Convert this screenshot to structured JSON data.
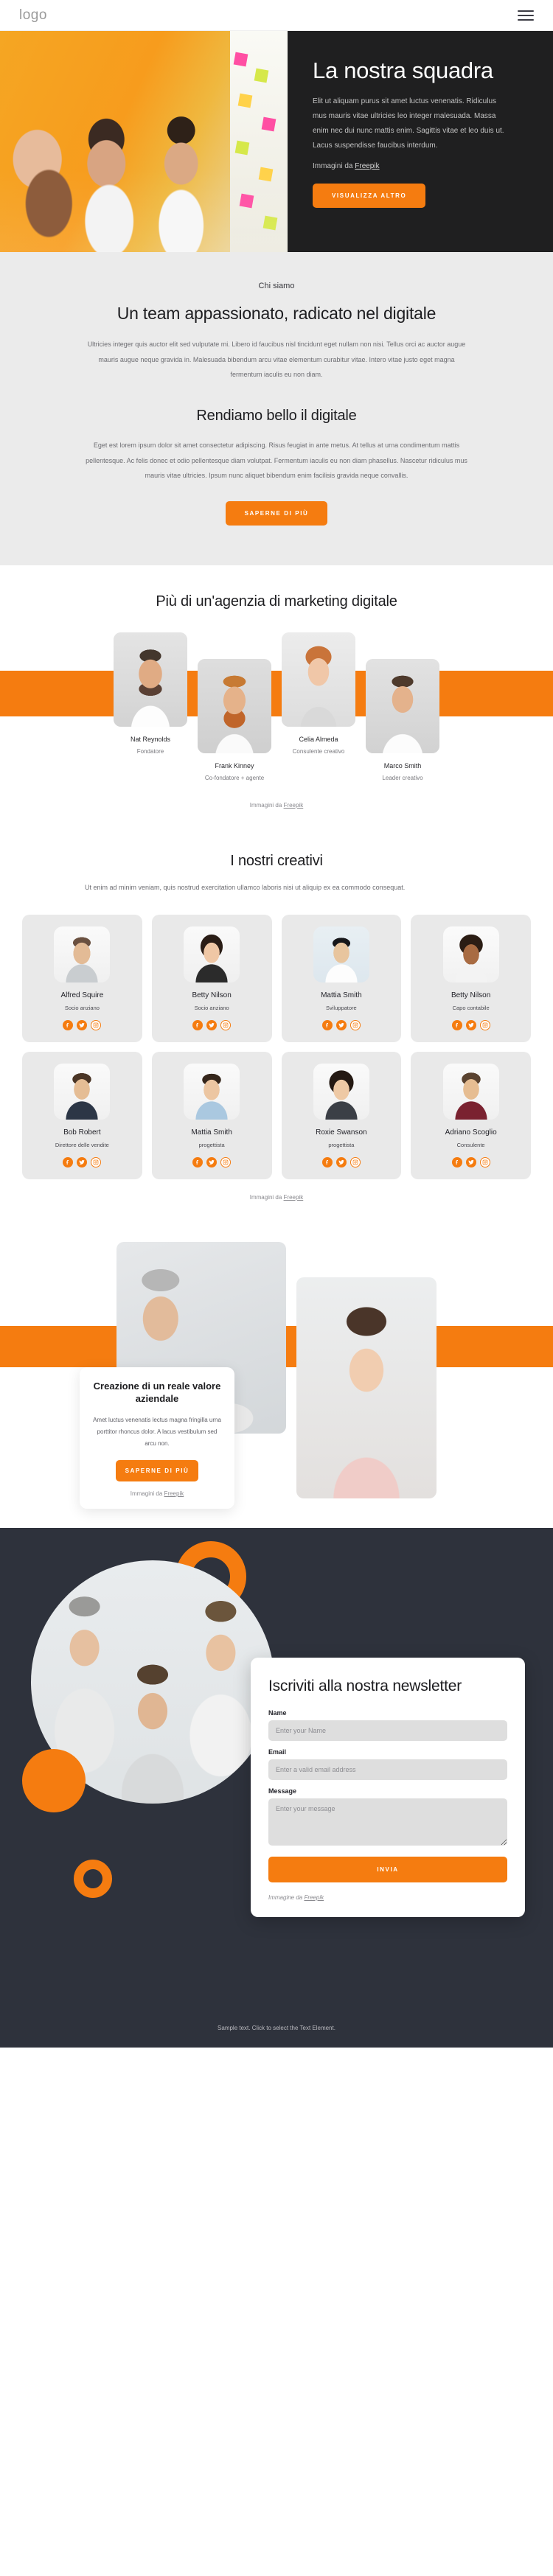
{
  "header": {
    "logo": "logo",
    "menu_icon": "hamburger-icon"
  },
  "colors": {
    "accent": "#f57c10",
    "dark": "#1f1f20",
    "footer_dark": "#2e323c",
    "light_gray": "#ebebeb"
  },
  "hero": {
    "title": "La nostra squadra",
    "paragraph": "Elit ut aliquam purus sit amet luctus venenatis. Ridiculus mus mauris vitae ultricies leo integer malesuada. Massa enim nec dui nunc mattis enim. Sagittis vitae et leo duis ut. Lacus suspendisse faucibus interdum.",
    "credit_prefix": "Immagini da ",
    "credit_link": "Freepik",
    "cta": "VISUALIZZA ALTRO"
  },
  "about": {
    "eyebrow": "Chi siamo",
    "heading": "Un team appassionato, radicato nel digitale",
    "paragraph": "Ultricies integer quis auctor elit sed vulputate mi. Libero id faucibus nisl tincidunt eget nullam non nisi. Tellus orci ac auctor augue mauris augue neque gravida in. Malesuada bibendum arcu vitae elementum curabitur vitae. Intero vitae justo eget magna fermentum iaculis eu non diam.",
    "heading2": "Rendiamo bello il digitale",
    "paragraph2": "Eget est lorem ipsum dolor sit amet consectetur adipiscing. Risus feugiat in ante metus. At tellus at urna condimentum mattis pellentesque. Ac felis donec et odio pellentesque diam volutpat. Fermentum iaculis eu non diam phasellus. Nascetur ridiculus mus mauris vitae ultricies. Ipsum nunc aliquet bibendum enim facilisis gravida neque convallis.",
    "cta": "SAPERNE DI PIÙ"
  },
  "team": {
    "heading": "Più di un'agenzia di marketing digitale",
    "members": [
      {
        "name": "Nat Reynolds",
        "role": "Fondatore"
      },
      {
        "name": "Frank Kinney",
        "role": "Co-fondatore + agente"
      },
      {
        "name": "Celia Almeda",
        "role": "Consulente creativo"
      },
      {
        "name": "Marco Smith",
        "role": "Leader creativo"
      }
    ],
    "credit_prefix": "Immagini da ",
    "credit_link": "Freepik"
  },
  "creatives": {
    "heading": "I nostri creativi",
    "paragraph": "Ut enim ad minim veniam, quis nostrud exercitation ullamco laboris nisi ut aliquip ex ea commodo consequat.",
    "cards": [
      {
        "name": "Alfred Squire",
        "role": "Socio anziano"
      },
      {
        "name": "Betty Nilson",
        "role": "Socio anziano"
      },
      {
        "name": "Mattia Smith",
        "role": "Sviluppatore"
      },
      {
        "name": "Betty Nilson",
        "role": "Capo contabile"
      },
      {
        "name": "Bob Robert",
        "role": "Direttore delle vendite"
      },
      {
        "name": "Mattia Smith",
        "role": "progettista"
      },
      {
        "name": "Roxie Swanson",
        "role": "progettista"
      },
      {
        "name": "Adriano Scoglio",
        "role": "Consulente"
      }
    ],
    "social_icons": [
      "facebook-icon",
      "twitter-icon",
      "instagram-icon"
    ],
    "credit_prefix": "Immagini da ",
    "credit_link": "Freepik"
  },
  "value": {
    "heading": "Creazione di un reale valore aziendale",
    "paragraph": "Amet luctus venenatis lectus magna fringilla urna porttitor rhoncus dolor. A lacus vestibulum sed arcu non.",
    "cta": "SAPERNE DI PIÙ",
    "credit_prefix": "Immagini da ",
    "credit_link": "Freepik"
  },
  "newsletter": {
    "heading": "Iscriviti alla nostra newsletter",
    "fields": {
      "name_label": "Name",
      "name_placeholder": "Enter your Name",
      "name_value": "",
      "email_label": "Email",
      "email_placeholder": "Enter a valid email address",
      "email_value": "",
      "message_label": "Message",
      "message_placeholder": "Enter your message",
      "message_value": ""
    },
    "submit": "INVIA",
    "credit_prefix": "Immagine da ",
    "credit_link": "Freepik"
  },
  "footer": {
    "text": "Sample text. Click to select the Text Element."
  }
}
